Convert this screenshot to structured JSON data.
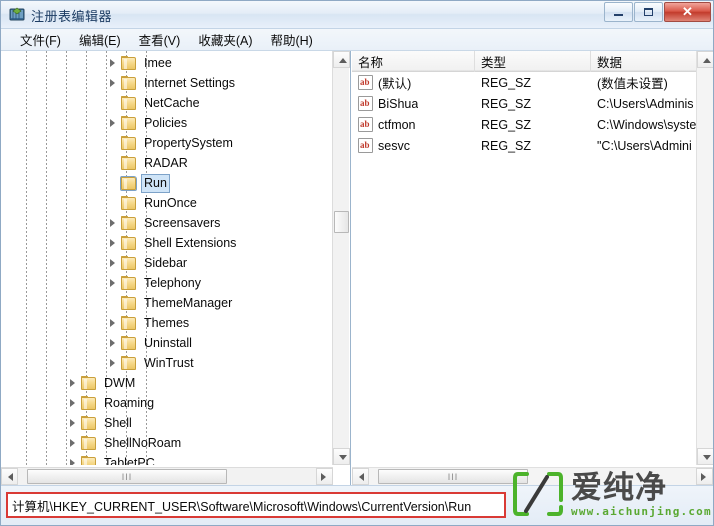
{
  "window": {
    "title": "注册表编辑器",
    "icon": "registry-editor-icon",
    "controls": {
      "minimize": "minimize",
      "maximize": "maximize",
      "close": "✕"
    }
  },
  "menu": {
    "items": [
      {
        "label": "文件(F)",
        "name": "menu-file"
      },
      {
        "label": "编辑(E)",
        "name": "menu-edit"
      },
      {
        "label": "查看(V)",
        "name": "menu-view"
      },
      {
        "label": "收藏夹(A)",
        "name": "menu-favorites"
      },
      {
        "label": "帮助(H)",
        "name": "menu-help"
      }
    ]
  },
  "tree": {
    "selected": "Run",
    "nodes": [
      {
        "label": "Imee",
        "depth": 5,
        "expandable": true,
        "selected": false
      },
      {
        "label": "Internet Settings",
        "depth": 5,
        "expandable": true,
        "selected": false
      },
      {
        "label": "NetCache",
        "depth": 5,
        "expandable": false,
        "selected": false
      },
      {
        "label": "Policies",
        "depth": 5,
        "expandable": true,
        "selected": false
      },
      {
        "label": "PropertySystem",
        "depth": 5,
        "expandable": false,
        "selected": false
      },
      {
        "label": "RADAR",
        "depth": 5,
        "expandable": false,
        "selected": false
      },
      {
        "label": "Run",
        "depth": 5,
        "expandable": false,
        "selected": true
      },
      {
        "label": "RunOnce",
        "depth": 5,
        "expandable": false,
        "selected": false
      },
      {
        "label": "Screensavers",
        "depth": 5,
        "expandable": true,
        "selected": false
      },
      {
        "label": "Shell Extensions",
        "depth": 5,
        "expandable": true,
        "selected": false
      },
      {
        "label": "Sidebar",
        "depth": 5,
        "expandable": true,
        "selected": false
      },
      {
        "label": "Telephony",
        "depth": 5,
        "expandable": true,
        "selected": false
      },
      {
        "label": "ThemeManager",
        "depth": 5,
        "expandable": false,
        "selected": false
      },
      {
        "label": "Themes",
        "depth": 5,
        "expandable": true,
        "selected": false
      },
      {
        "label": "Uninstall",
        "depth": 5,
        "expandable": true,
        "selected": false
      },
      {
        "label": "WinTrust",
        "depth": 5,
        "expandable": true,
        "selected": false
      },
      {
        "label": "DWM",
        "depth": 3,
        "expandable": true,
        "selected": false
      },
      {
        "label": "Roaming",
        "depth": 3,
        "expandable": true,
        "selected": false
      },
      {
        "label": "Shell",
        "depth": 3,
        "expandable": true,
        "selected": false
      },
      {
        "label": "ShellNoRoam",
        "depth": 3,
        "expandable": true,
        "selected": false
      },
      {
        "label": "TabletPC",
        "depth": 3,
        "expandable": true,
        "selected": false
      }
    ]
  },
  "values": {
    "columns": [
      {
        "label": "名称",
        "name": "column-name"
      },
      {
        "label": "类型",
        "name": "column-type"
      },
      {
        "label": "数据",
        "name": "column-data"
      }
    ],
    "rows": [
      {
        "name": "(默认)",
        "type": "REG_SZ",
        "data": "(数值未设置)"
      },
      {
        "name": "BiShua",
        "type": "REG_SZ",
        "data": "C:\\Users\\Adminis"
      },
      {
        "name": "ctfmon",
        "type": "REG_SZ",
        "data": "C:\\Windows\\syste"
      },
      {
        "name": "sesvc",
        "type": "REG_SZ",
        "data": "\"C:\\Users\\Admini"
      }
    ]
  },
  "statusbar": {
    "path": "计算机\\HKEY_CURRENT_USER\\Software\\Microsoft\\Windows\\CurrentVersion\\Run",
    "highlight_color": "#d93a35"
  },
  "watermark": {
    "brand": "爱纯净",
    "url": "www.aichunjing.com",
    "accent_color": "#5aa832"
  },
  "scrollbars": {
    "tree_v_grip": "",
    "tree_h_grip": "III",
    "right_h_grip": "III"
  }
}
